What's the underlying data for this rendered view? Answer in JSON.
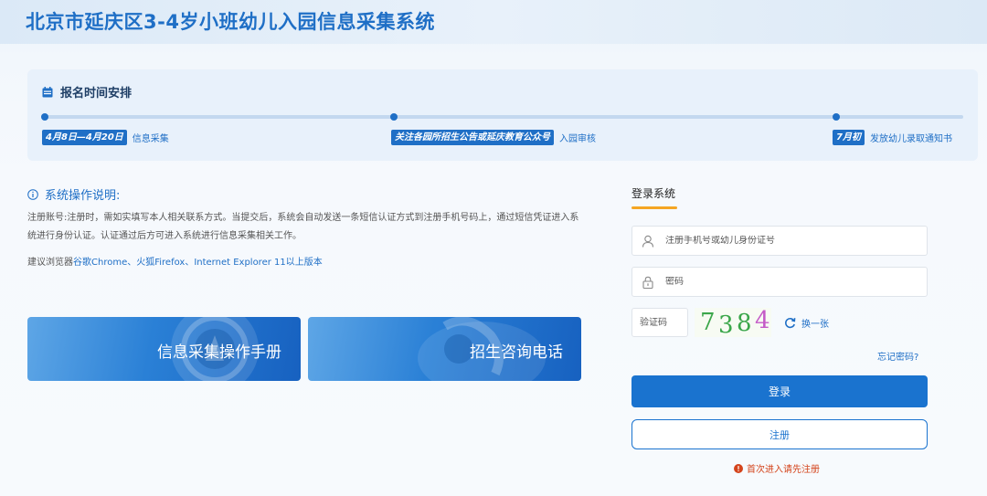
{
  "header": {
    "title": "北京市延庆区3-4岁小班幼儿入园信息采集系统"
  },
  "schedule": {
    "title": "报名时间安排",
    "steps": [
      {
        "badge": "4月8日—4月20日",
        "text": "信息采集"
      },
      {
        "badge": "关注各园所招生公告或延庆教育公众号",
        "text": "入园审核"
      },
      {
        "badge": "7月初",
        "text": "发放幼儿录取通知书"
      }
    ]
  },
  "instructions": {
    "title": "系统操作说明:",
    "body": "注册账号:注册时，需如实填写本人相关联系方式。当提交后，系统会自动发送一条短信认证方式到注册手机号码上，通过短信凭证进入系统进行身份认证。认证通过后方可进入系统进行信息采集相关工作。",
    "browser_prefix": "建议浏览器",
    "browser_list": "谷歌Chrome、火狐Firefox、Internet Explorer 11以上版本"
  },
  "banners": [
    {
      "label": "信息采集操作手册"
    },
    {
      "label": "招生咨询电话"
    }
  ],
  "login": {
    "tab": "登录系统",
    "username_placeholder": "注册手机号或幼儿身份证号",
    "password_placeholder": "密码",
    "captcha_placeholder": "验证码",
    "captcha_chars": [
      "7",
      "3",
      "8",
      "4"
    ],
    "captcha_colors": [
      "#3aa64a",
      "#3aa64a",
      "#3aa64a",
      "#c45bc7"
    ],
    "refresh_label": "换一张",
    "forgot_label": "忘记密码?",
    "login_button": "登录",
    "register_button": "注册",
    "notice": "首次进入请先注册"
  },
  "colors": {
    "primary": "#1f6fc6",
    "accent": "#f5a623",
    "warning": "#d4441c"
  }
}
